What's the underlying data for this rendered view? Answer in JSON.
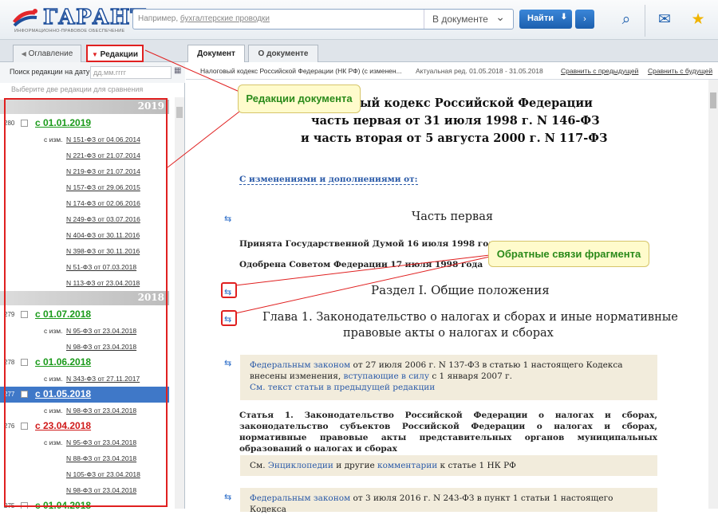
{
  "header": {
    "logo_text": "ГАРАНТ",
    "logo_tagline": "ИНФОРМАЦИОННО-ПРАВОВОЕ ОБЕСПЕЧЕНИЕ",
    "search_placeholder_prefix": "Например, ",
    "search_placeholder_link": "бухгалтерские проводки",
    "search_scope": "В документе",
    "find_label": "Найти",
    "icons": [
      "search-settings-icon",
      "messages-icon",
      "star-icon"
    ]
  },
  "left_tabs": [
    {
      "label": "Оглавление"
    },
    {
      "label": "Редакции"
    }
  ],
  "doc_tabs": [
    {
      "label": "Документ"
    },
    {
      "label": "О документе"
    }
  ],
  "left_panel": {
    "search_label": "Поиск редакции на дату",
    "search_placeholder": "дд.мм.гггг",
    "hint": "Выберите две редакции для сравнения",
    "year_2019": "2019",
    "year_2018": "2018",
    "changes_prefix": "с изм.",
    "editions": [
      {
        "num": "280",
        "date": "с 01.01.2019",
        "changes": [
          "N 151-ФЗ от 04.06.2014",
          "N 221-ФЗ от 21.07.2014",
          "N 219-ФЗ от 21.07.2014",
          "N 157-ФЗ от 29.06.2015",
          "N 174-ФЗ от 02.06.2016",
          "N 249-ФЗ от 03.07.2016",
          "N 404-ФЗ от 30.11.2016",
          "N 398-ФЗ от 30.11.2016",
          "N 51-ФЗ от 07.03.2018",
          "N 113-ФЗ от 23.04.2018"
        ]
      },
      {
        "num": "279",
        "date": "с 01.07.2018",
        "changes": [
          "N 95-ФЗ от 23.04.2018",
          "N 98-ФЗ от 23.04.2018"
        ]
      },
      {
        "num": "278",
        "date": "с 01.06.2018",
        "changes": [
          "N 343-ФЗ от 27.11.2017"
        ]
      },
      {
        "num": "277",
        "date": "с 01.05.2018",
        "changes": [
          "N 98-ФЗ от 23.04.2018"
        ]
      },
      {
        "num": "276",
        "date": "с 23.04.2018",
        "changes": [
          "N 95-ФЗ от 23.04.2018",
          "N 88-ФЗ от 23.04.2018",
          "N 105-ФЗ от 23.04.2018",
          "N 98-ФЗ от 23.04.2018"
        ]
      },
      {
        "num": "275",
        "date": "с 01.04.2018",
        "changes": []
      }
    ]
  },
  "info_bar": {
    "doc_name": "Налоговый кодекс Российской Федерации (НК РФ) (с изменен...",
    "actual": "Актуальная ред. 01.05.2018 - 31.05.2018",
    "compare_prev": "Сравнить с предыдущей",
    "compare_next": "Сравнить с будущей"
  },
  "document": {
    "title_1": "ый кодекс Российской Федерации",
    "title_2": "часть первая от 31 июля 1998 г. N 146-ФЗ",
    "title_3": "и часть вторая от 5 августа 2000 г. N 117-ФЗ",
    "changes_link": "С изменениями и дополнениями от:",
    "part": "Часть первая",
    "adopted": "Принята Государственной Думой 16 июля 1998 года",
    "approved": "Одобрена Советом Федерации 17 июля 1998 года",
    "section": "Раздел I. Общие положения",
    "chapter_1": "Глава 1. Законодательство о налогах и сборах и иные нормативные",
    "chapter_2": "правовые акты о налогах и сборах",
    "note1_link": "Федеральным законом",
    "note1_text": " от 27 июля 2006 г. N 137-ФЗ в статью 1 настоящего Кодекса внесены изменения, ",
    "note1_link2": "вступающие в силу",
    "note1_text2": " с 1 января 2007 г.",
    "note1_link3": "См. текст статьи в предыдущей редакции",
    "article1": "Статья 1. Законодательство Российской Федерации о налогах и сборах, законодательство субъектов Российской Федерации о налогах и сборах, нормативные правовые акты представительных органов муниципальных образований о налогах и сборах",
    "see_prefix": "См. ",
    "see_link1": "Энциклопедии",
    "see_mid": " и другие ",
    "see_link2": "комментарии",
    "see_suffix": " к статье 1 НК РФ",
    "note2_link": "Федеральным законом",
    "note2_text": " от 3 июля 2016 г. N 243-ФЗ в пункт 1 статьи 1 настоящего Кодекса"
  },
  "callouts": {
    "editions": "Редакции документа",
    "backlinks": "Обратные связи фрагмента"
  }
}
